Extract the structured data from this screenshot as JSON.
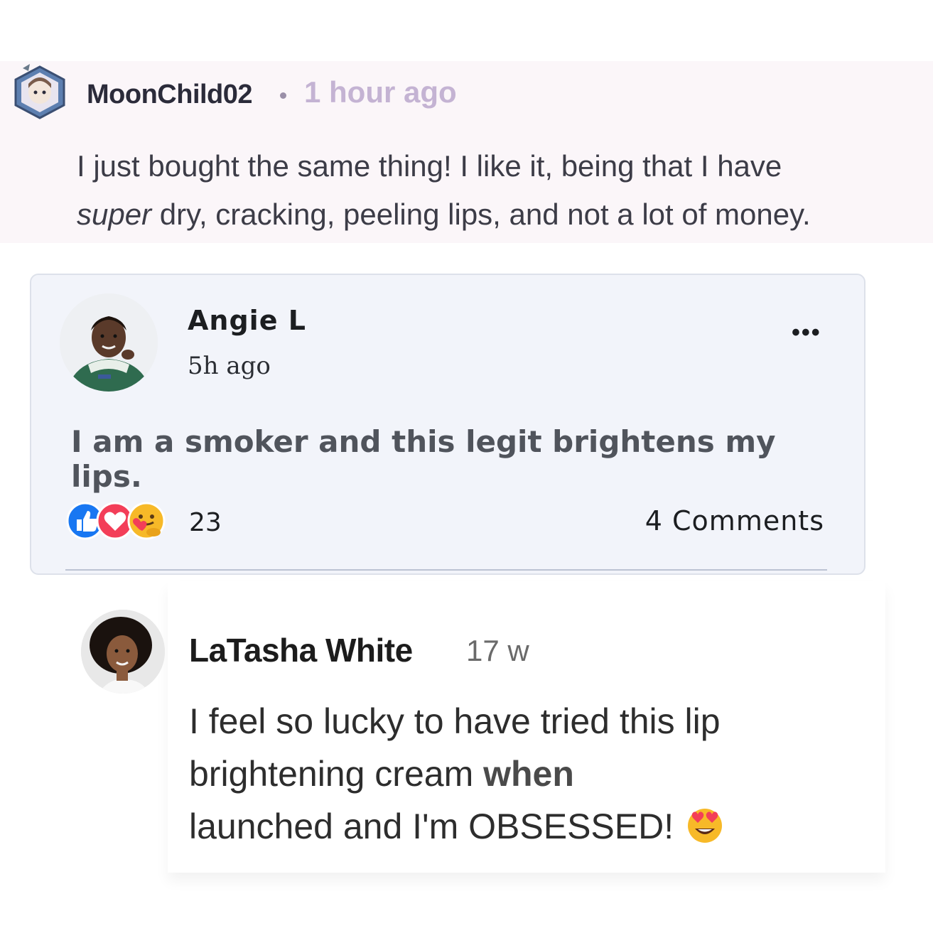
{
  "comments": [
    {
      "username": "MoonChild02",
      "time": "1 hour ago",
      "text_emph": "super",
      "text_line1": "I just bought the same thing! I like it, being that I have",
      "text_line2_rest": " dry, cracking, peeling lips, and not a lot of money."
    },
    {
      "username": "Angie L",
      "time": "5h ago",
      "more": "•••",
      "text": "I am a smoker and this legit brightens my lips.",
      "reaction_count": "23",
      "comments_label": "4 Comments",
      "reactions": [
        "like-icon",
        "love-icon",
        "care-icon"
      ]
    },
    {
      "username": "LaTasha White",
      "time": "17 w",
      "text_line1": "I feel so lucky to have tried this lip",
      "text_line2": "brightening cream",
      "text_line2_bold": " when",
      "text_line3": "launched and I'm OBSESSED!",
      "emoji": "heart-eyes-emoji"
    }
  ],
  "colors": {
    "like_blue": "#1877f2",
    "love_red": "#f33e58",
    "care_yellow": "#f7b928",
    "muted_lilac": "#c4b3d3"
  }
}
